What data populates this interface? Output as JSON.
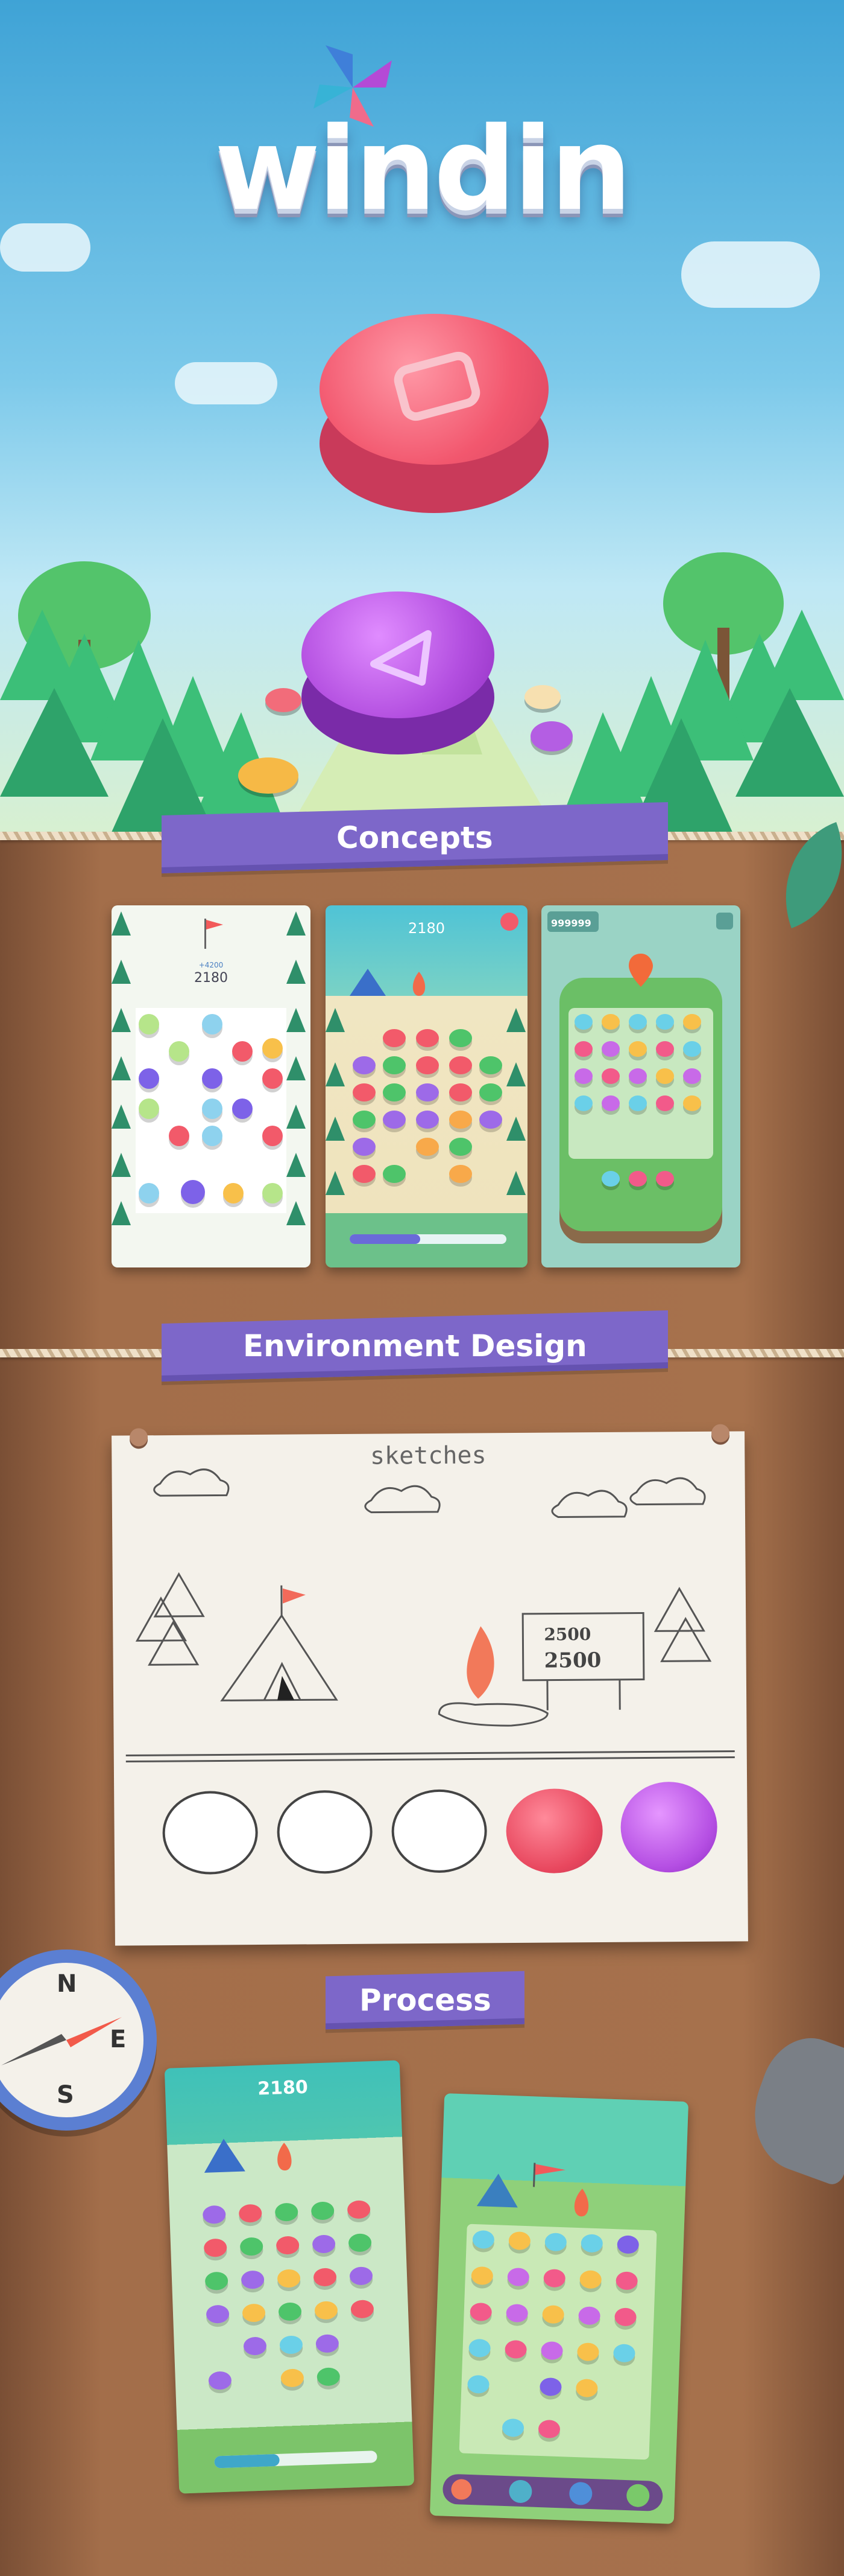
{
  "hero": {
    "logo": "windin"
  },
  "sections": {
    "concepts": "Concepts",
    "environment": "Environment Design",
    "process": "Process"
  },
  "concepts_screens": {
    "screen1": {
      "bonus": "+4200",
      "score": "2180"
    },
    "screen2": {
      "score": "2180"
    },
    "screen3": {
      "score": "999999"
    }
  },
  "sketch_paper": {
    "title": "sketches",
    "sign_line1": "2500",
    "sign_line2": "2500"
  },
  "compass": {
    "north": "N",
    "east": "E",
    "south": "S"
  },
  "process_screens": {
    "screen1": {
      "score": "2180"
    }
  },
  "colors": {
    "sky": "#4fb0df",
    "ribbon": "#7d67c9",
    "dirt": "#a36e4a",
    "coin_red": "#f05a6e",
    "coin_purple": "#b34fe0"
  }
}
